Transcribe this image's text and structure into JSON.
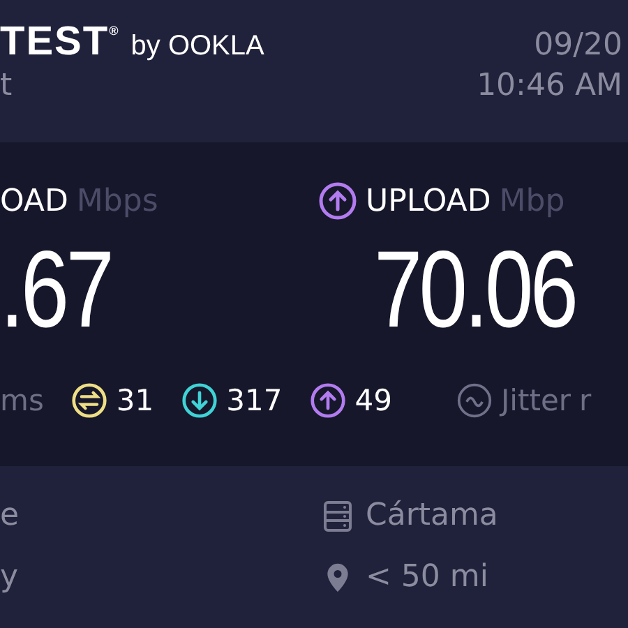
{
  "header": {
    "wordmark": "TEST$^{®}$",
    "by": "by OOKLA",
    "subtitle": "t",
    "date": "09/20",
    "time": "10:46 AM"
  },
  "results": [
    {
      "label": "OAD",
      "unit": "Mbps",
      "value": ".67"
    },
    {
      "kind": "upload",
      "label": "UPLOAD",
      "unit": "Mbp",
      "value": "70.06"
    }
  ],
  "ping": {
    "unit": "ms",
    "stats": [
      {
        "kind": "idle",
        "value": "31"
      },
      {
        "kind": "download",
        "value": "317"
      },
      {
        "kind": "upload",
        "value": "49"
      }
    ]
  },
  "jitter": {
    "label": "Jitter",
    "unit": "r"
  },
  "isp": {
    "line_1": "e",
    "line_2": "y"
  },
  "server": {
    "name": "Cártama",
    "distance": "< 50 mi"
  }
}
